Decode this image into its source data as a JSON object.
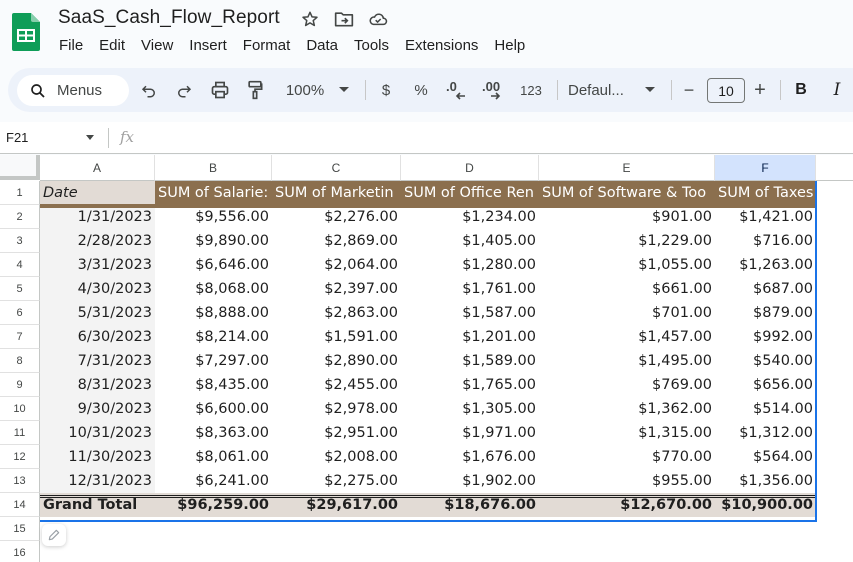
{
  "app": {
    "title": "SaaS_Cash_Flow_Report",
    "title_icons": [
      "star-icon",
      "move-to-folder-icon",
      "cloud-saved-icon"
    ],
    "menu": [
      "File",
      "Edit",
      "View",
      "Insert",
      "Format",
      "Data",
      "Tools",
      "Extensions",
      "Help"
    ]
  },
  "toolbar": {
    "search_label": "Menus",
    "zoom": "100%",
    "currency": "$",
    "percent": "%",
    "decrease_decimal": ".0",
    "increase_decimal": ".00",
    "number_format": "123",
    "font": "Defaul...",
    "font_size": "10",
    "minus": "−",
    "plus": "+",
    "bold": "B",
    "italic": "I"
  },
  "formula_bar": {
    "name_box": "F21",
    "fx": "fx",
    "value": ""
  },
  "colors": {
    "header_bg": "#8b6f4e",
    "total_bg": "#e2dbd5",
    "selection": "#1a73e8",
    "selected_col_header": "#d3e3fd"
  },
  "sheet": {
    "columns": [
      "A",
      "B",
      "C",
      "D",
      "E",
      "F"
    ],
    "selected_column": "F",
    "row_numbers": [
      "1",
      "2",
      "3",
      "4",
      "5",
      "6",
      "7",
      "8",
      "9",
      "10",
      "11",
      "12",
      "13",
      "14",
      "15",
      "16"
    ],
    "header": [
      "Date",
      "SUM of Salaries",
      "SUM of Marketing",
      "SUM of Office Rent",
      "SUM of Software & Tools",
      "SUM of Taxes"
    ],
    "header_visible": [
      "Date",
      "SUM of Salarie:",
      "SUM of Marketin",
      "SUM of Office Ren",
      "SUM of Software & Too",
      "SUM of Taxes"
    ],
    "rows": [
      [
        "1/31/2023",
        "$9,556.00",
        "$2,276.00",
        "$1,234.00",
        "$901.00",
        "$1,421.00"
      ],
      [
        "2/28/2023",
        "$9,890.00",
        "$2,869.00",
        "$1,405.00",
        "$1,229.00",
        "$716.00"
      ],
      [
        "3/31/2023",
        "$6,646.00",
        "$2,064.00",
        "$1,280.00",
        "$1,055.00",
        "$1,263.00"
      ],
      [
        "4/30/2023",
        "$8,068.00",
        "$2,397.00",
        "$1,761.00",
        "$661.00",
        "$687.00"
      ],
      [
        "5/31/2023",
        "$8,888.00",
        "$2,863.00",
        "$1,587.00",
        "$701.00",
        "$879.00"
      ],
      [
        "6/30/2023",
        "$8,214.00",
        "$1,591.00",
        "$1,201.00",
        "$1,457.00",
        "$992.00"
      ],
      [
        "7/31/2023",
        "$7,297.00",
        "$2,890.00",
        "$1,589.00",
        "$1,495.00",
        "$540.00"
      ],
      [
        "8/31/2023",
        "$8,435.00",
        "$2,455.00",
        "$1,765.00",
        "$769.00",
        "$656.00"
      ],
      [
        "9/30/2023",
        "$6,600.00",
        "$2,978.00",
        "$1,305.00",
        "$1,362.00",
        "$514.00"
      ],
      [
        "10/31/2023",
        "$8,363.00",
        "$2,951.00",
        "$1,971.00",
        "$1,315.00",
        "$1,312.00"
      ],
      [
        "11/30/2023",
        "$8,061.00",
        "$2,008.00",
        "$1,676.00",
        "$770.00",
        "$564.00"
      ],
      [
        "12/31/2023",
        "$6,241.00",
        "$2,275.00",
        "$1,902.00",
        "$955.00",
        "$1,356.00"
      ]
    ],
    "total": [
      "Grand Total",
      "$96,259.00",
      "$29,617.00",
      "$18,676.00",
      "$12,670.00",
      "$10,900.00"
    ]
  }
}
